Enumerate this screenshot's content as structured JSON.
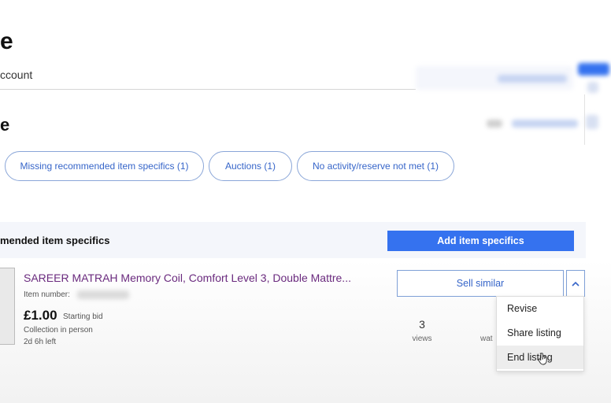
{
  "page": {
    "heading_fragment_1": "e",
    "tab_fragment": "ccount",
    "heading_fragment_2": "e"
  },
  "filters": {
    "chips": [
      {
        "label": "Missing recommended item specifics (1)"
      },
      {
        "label": "Auctions (1)"
      },
      {
        "label": "No activity/reserve not met (1)"
      }
    ]
  },
  "banner": {
    "text": "mended item specifics",
    "button_label": "Add item specifics"
  },
  "listing": {
    "title": "SAREER MATRAH Memory Coil, Comfort Level 3, Double Mattre...",
    "item_number_label": "Item number:",
    "price": "£1.00",
    "price_type": "Starting bid",
    "collection": "Collection in person",
    "time_left": "2d 6h left",
    "views_count": "3",
    "views_label": "views",
    "watchers_label_fragment": "wat",
    "sell_similar_label": "Sell similar"
  },
  "actions_menu": {
    "items": [
      "Revise",
      "Share listing",
      "End listing"
    ]
  },
  "colors": {
    "accent_blue": "#3572ef",
    "link_blue": "#3665c9",
    "title_purple": "#6a2a7e",
    "banner_bg": "#f4f6fb"
  },
  "icons": {
    "chevron": "chevron-up-icon",
    "cursor": "hand-cursor-icon"
  }
}
